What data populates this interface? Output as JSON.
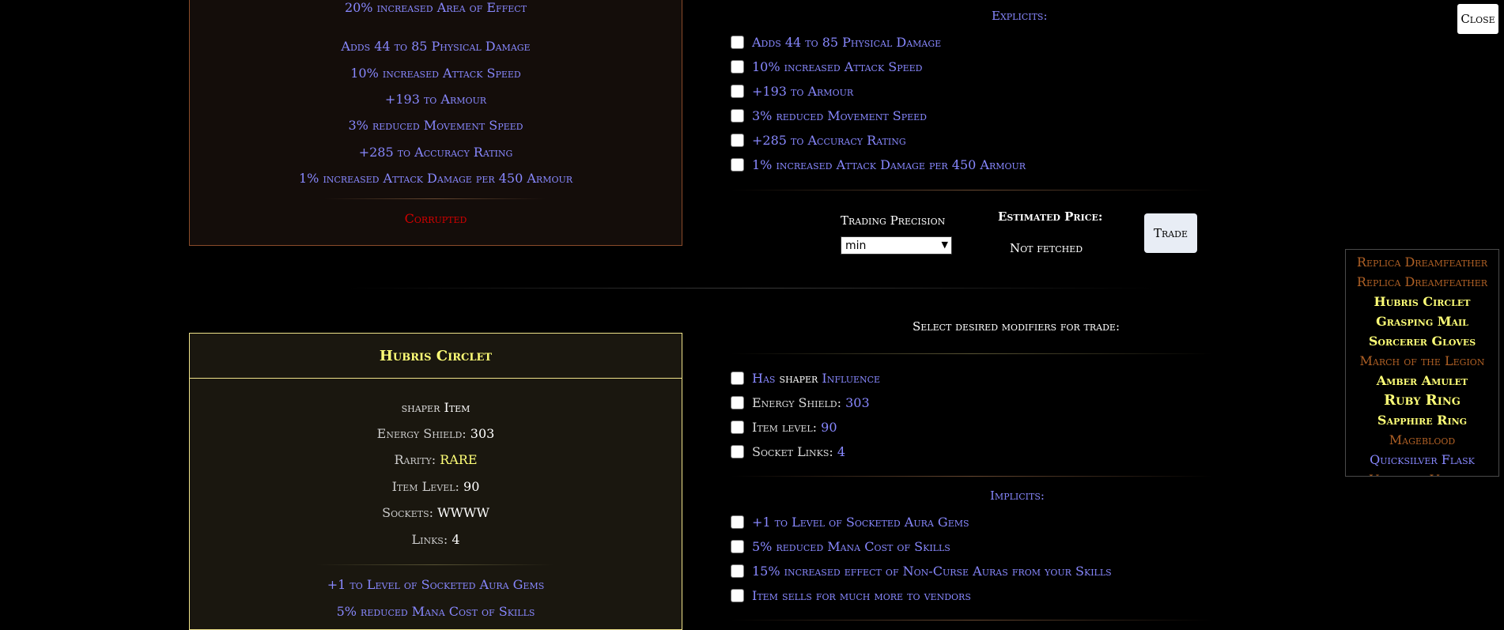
{
  "top_item": {
    "partial_mod": "20% increased Area of Effect",
    "mods": [
      "Adds 44 to 85 Physical Damage",
      "10% increased Attack Speed",
      "+193 to Armour",
      "3% reduced Movement Speed",
      "+285 to Accuracy Rating",
      "1% increased Attack Damage per 450 Armour"
    ],
    "corrupted": "Corrupted"
  },
  "explicits_section": {
    "title": "Explicits:",
    "options": [
      "Adds 44 to 85 Physical Damage",
      "10% increased Attack Speed",
      "+193 to Armour",
      "3% reduced Movement Speed",
      "+285 to Accuracy Rating",
      "1% increased Attack Damage per 450 Armour"
    ]
  },
  "trade_controls": {
    "precision_label": "Trading Precision",
    "precision_value": "min",
    "price_label": "Estimated Price:",
    "price_value": "Not fetched",
    "trade_button": "Trade"
  },
  "close_button": "Close",
  "hubris_item": {
    "name": "Hubris Circlet",
    "influence_word": "shaper",
    "item_word": "Item",
    "energy_shield_label": "Energy Shield:",
    "energy_shield_value": "303",
    "rarity_label": "Rarity:",
    "rarity_value": "RARE",
    "item_level_label": "Item Level:",
    "item_level_value": "90",
    "sockets_label": "Sockets:",
    "sockets_value": "WWWW",
    "links_label": "Links:",
    "links_value": "4",
    "implicits": [
      "+1 to Level of Socketed Aura Gems",
      "5% reduced Mana Cost of Skills"
    ]
  },
  "select_modifiers": {
    "title": "Select desired modifiers for trade:",
    "props": [
      {
        "label": "Has",
        "middle": "shaper",
        "value": "Influence"
      },
      {
        "label": "Energy Shield:",
        "value": "303"
      },
      {
        "label": "Item level:",
        "value": "90"
      },
      {
        "label": "Socket Links:",
        "value": "4"
      }
    ]
  },
  "implicits_section": {
    "title": "Implicits:",
    "options": [
      "+1 to Level of Socketed Aura Gems",
      "5% reduced Mana Cost of Skills",
      "15% increased effect of Non-Curse Auras from your Skills",
      "Item sells for much more to vendors"
    ]
  },
  "sidebar": {
    "items": [
      {
        "label": "Replica Dreamfeather",
        "rarity": "unique"
      },
      {
        "label": "Replica Dreamfeather",
        "rarity": "unique"
      },
      {
        "label": "Hubris Circlet",
        "rarity": "rare"
      },
      {
        "label": "Grasping Mail",
        "rarity": "rare"
      },
      {
        "label": "Sorcerer Gloves",
        "rarity": "rare"
      },
      {
        "label": "March of the Legion",
        "rarity": "unique"
      },
      {
        "label": "Amber Amulet",
        "rarity": "rare"
      },
      {
        "label": "Ruby Ring",
        "rarity": "rare"
      },
      {
        "label": "Sapphire Ring",
        "rarity": "rare"
      },
      {
        "label": "Mageblood",
        "rarity": "unique"
      },
      {
        "label": "Quicksilver Flask",
        "rarity": "magic"
      },
      {
        "label": "Vessel of Vinktar",
        "rarity": "unique"
      }
    ]
  },
  "colors": {
    "magic_mod": "#8888ff",
    "rare_gold": "#ffff77",
    "unique_orange": "#af6025",
    "corrupted_red": "#d20000"
  }
}
